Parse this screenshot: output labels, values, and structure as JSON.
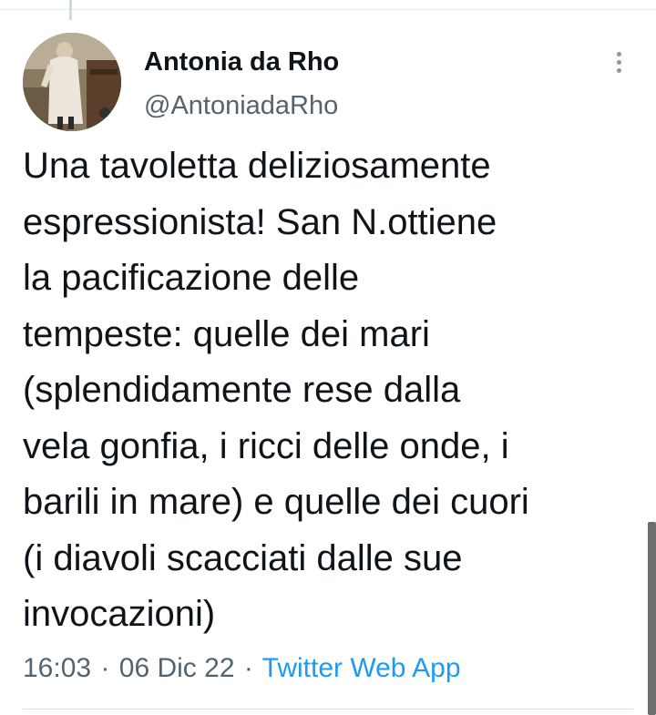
{
  "tweet": {
    "author_name": "Antonia da Rho",
    "author_handle": "@AntoniadaRho",
    "text": "Una tavoletta deliziosamente\nespressionista! San N.ottiene\nla pacificazione delle\ntempeste: quelle dei mari\n(splendidamente rese dalla\nvela gonfia, i ricci delle onde, i\nbarili in mare) e quelle dei cuori\n(i diavoli scacciati dalle sue\ninvocazioni)",
    "time": "16:03",
    "separator": "·",
    "date": "06 Dic 22",
    "source": "Twitter Web App"
  },
  "icons": {
    "more": "more-vertical-icon",
    "avatar": "profile-photo"
  },
  "colors": {
    "text": "#0f1419",
    "secondary": "#536471",
    "link": "#1d9bf0",
    "border": "#e6ecf0"
  }
}
